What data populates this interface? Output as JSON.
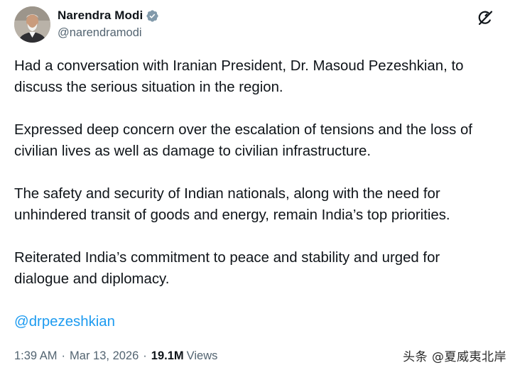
{
  "author": {
    "name": "Narendra Modi",
    "handle": "@narendramodi",
    "verified": true
  },
  "tweet": {
    "paragraphs": [
      [
        "Had a conversation with Iranian President, Dr. Masoud Pezeshkian, to",
        "discuss the serious situation in the region."
      ],
      [
        "Expressed deep concern over the escalation of tensions and the loss of",
        "civilian lives as well as damage to civilian infrastructure."
      ],
      [
        "The safety and security of Indian nationals, along with the need for",
        "unhindered transit of goods and energy, remain India’s top priorities."
      ],
      [
        "Reiterated India’s commitment to peace and stability and urged for",
        "dialogue and diplomacy."
      ]
    ],
    "mention": "@drpezeshkian"
  },
  "meta": {
    "time": "1:39 AM",
    "separator": "·",
    "date": "Mar 13, 2026",
    "views_count": "19.1M",
    "views_label": "Views"
  },
  "watermark": "头条 @夏威夷北岸",
  "icons": {
    "verified": "verified-badge-icon",
    "grok": "grok-icon"
  },
  "colors": {
    "text": "#0f1419",
    "secondary": "#536471",
    "accent": "#1d9bf0"
  }
}
